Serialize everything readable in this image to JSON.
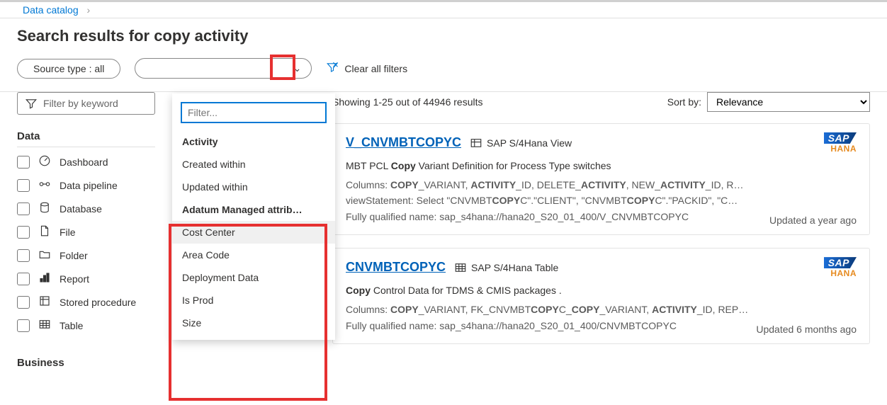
{
  "breadcrumb": {
    "root": "Data catalog"
  },
  "title": "Search results for copy activity",
  "filters": {
    "source_chip": "Source type : all",
    "clear_label": "Clear all filters",
    "keyword_placeholder": "Filter by keyword"
  },
  "dropdown": {
    "filter_placeholder": "Filter...",
    "section1": "Activity",
    "items1": [
      "Created within",
      "Updated within"
    ],
    "section2": "Adatum Managed attrib…",
    "items2": [
      "Cost Center",
      "Area Code",
      "Deployment Data",
      "Is Prod",
      "Size"
    ]
  },
  "facets": {
    "group1_title": "Data",
    "group1": [
      {
        "label": "Dashboard"
      },
      {
        "label": "Data pipeline"
      },
      {
        "label": "Database"
      },
      {
        "label": "File"
      },
      {
        "label": "Folder"
      },
      {
        "label": "Report"
      },
      {
        "label": "Stored procedure"
      },
      {
        "label": "Table"
      }
    ],
    "group2_title": "Business"
  },
  "results": {
    "showing": "Showing 1-25 out of 44946 results",
    "sort_label": "Sort by:",
    "sort_value": "Relevance"
  },
  "cards": [
    {
      "title": "V_CNVMBTCOPYC",
      "subtype": "SAP S/4Hana View",
      "desc_pre": "MBT PCL ",
      "desc_bold": "Copy",
      "desc_post": " Variant Definition for Process Type switches",
      "line1_label": "Columns: ",
      "line1_html": "<b>COPY</b>_VARIANT, <b>ACTIVITY</b>_ID, DELETE_<b>ACTIVITY</b>, NEW_<b>ACTIVITY</b>_ID, R…",
      "line2_label": "viewStatement: ",
      "line2_html": "Select \"CNVMBT<b>COPY</b>C\".\"CLIENT\", \"CNVMBT<b>COPY</b>C\".\"PACKID\", \"C…",
      "line3_label": "Fully qualified name: ",
      "line3": "sap_s4hana://hana20_S20_01_400/V_CNVMBTCOPYC",
      "updated": "Updated a year ago",
      "badge": "SAP",
      "hana": "HANA"
    },
    {
      "title": "CNVMBTCOPYC",
      "subtype": "SAP S/4Hana Table",
      "desc_bold": "Copy",
      "desc_post": " Control Data for TDMS & CMIS packages .",
      "line1_label": "Columns: ",
      "line1_html": "<b>COPY</b>_VARIANT, FK_CNVMBT<b>COPY</b>C_<b>COPY</b>_VARIANT, <b>ACTIVITY</b>_ID, REP…",
      "line3_label": "Fully qualified name: ",
      "line3": "sap_s4hana://hana20_S20_01_400/CNVMBTCOPYC",
      "updated": "Updated 6 months ago",
      "badge": "SAP",
      "hana": "HANA"
    }
  ]
}
